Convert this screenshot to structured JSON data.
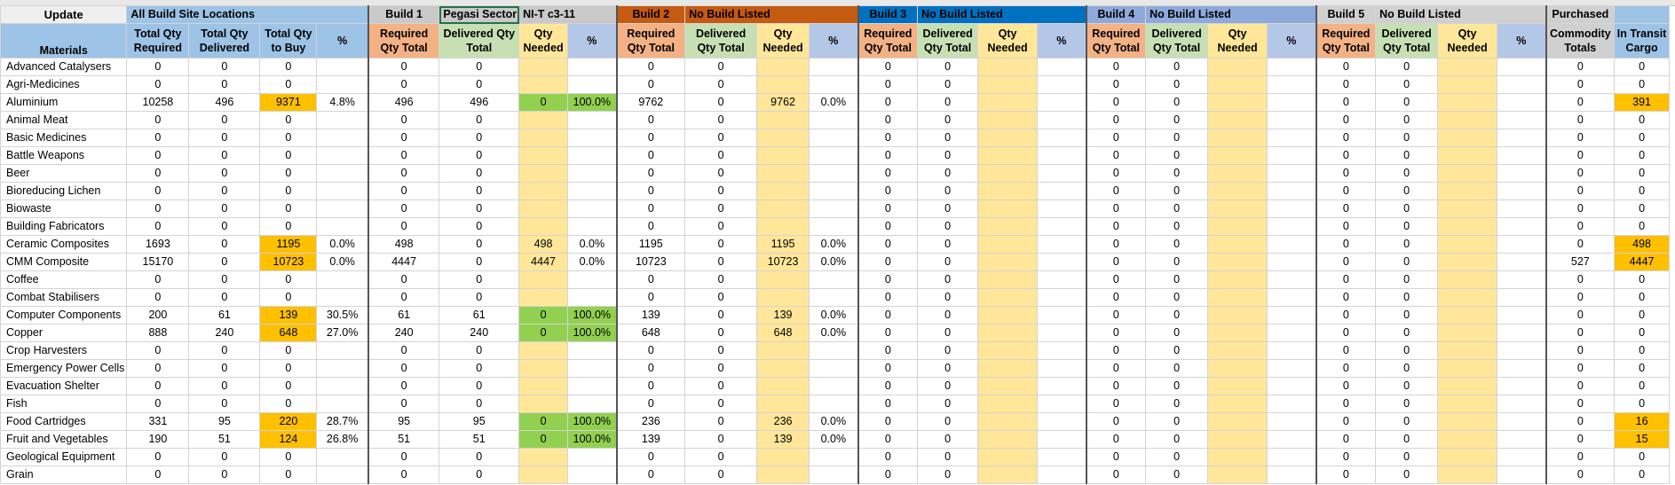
{
  "update_label": "Update",
  "header1": {
    "all_sites": "All Build Site Locations",
    "build1": "Build 1",
    "build1_site": "Pegasi Sector",
    "build1_site2": "NI-T c3-11",
    "build2": "Build 2",
    "build2_site": "No Build Listed",
    "build3": "Build 3",
    "build3_site": "No Build Listed",
    "build4": "Build 4",
    "build4_site": "No Build Listed",
    "build5": "Build 5",
    "build5_site": "No Build Listed",
    "purchased": "Purchased",
    "in_transit": ""
  },
  "header2": {
    "materials": "Materials",
    "total_req": "Total Qty Required",
    "total_del": "Total Qty Delivered",
    "total_buy": "Total Qty to Buy",
    "pct": "%",
    "req_total": "Required Qty Total",
    "del_total": "Delivered Qty Total",
    "qty_needed": "Qty Needed",
    "commodity": "Commodity Totals",
    "in_transit": "In Transit Cargo"
  },
  "rows": [
    {
      "name": "Advanced Catalysers",
      "tr": "0",
      "td": "0",
      "tb": "0",
      "p": "",
      "b1r": "0",
      "b1d": "0",
      "b1n": "",
      "b1p": "",
      "b2r": "0",
      "b2d": "0",
      "b2n": "",
      "b2p": "",
      "pur": "0",
      "tra": "0"
    },
    {
      "name": "Agri-Medicines",
      "tr": "0",
      "td": "0",
      "tb": "0",
      "p": "",
      "b1r": "0",
      "b1d": "0",
      "b1n": "",
      "b1p": "",
      "b2r": "0",
      "b2d": "0",
      "b2n": "",
      "b2p": "",
      "pur": "0",
      "tra": "0"
    },
    {
      "name": "Aluminium",
      "tr": "10258",
      "td": "496",
      "tb": "9371",
      "p": "4.8%",
      "b1r": "496",
      "b1d": "496",
      "b1n": "0",
      "b1p": "100.0%",
      "b2r": "9762",
      "b2d": "0",
      "b2n": "9762",
      "b2p": "0.0%",
      "pur": "0",
      "tra": "391"
    },
    {
      "name": "Animal Meat",
      "tr": "0",
      "td": "0",
      "tb": "0",
      "p": "",
      "b1r": "0",
      "b1d": "0",
      "b1n": "",
      "b1p": "",
      "b2r": "0",
      "b2d": "0",
      "b2n": "",
      "b2p": "",
      "pur": "0",
      "tra": "0"
    },
    {
      "name": "Basic Medicines",
      "tr": "0",
      "td": "0",
      "tb": "0",
      "p": "",
      "b1r": "0",
      "b1d": "0",
      "b1n": "",
      "b1p": "",
      "b2r": "0",
      "b2d": "0",
      "b2n": "",
      "b2p": "",
      "pur": "0",
      "tra": "0"
    },
    {
      "name": "Battle Weapons",
      "tr": "0",
      "td": "0",
      "tb": "0",
      "p": "",
      "b1r": "0",
      "b1d": "0",
      "b1n": "",
      "b1p": "",
      "b2r": "0",
      "b2d": "0",
      "b2n": "",
      "b2p": "",
      "pur": "0",
      "tra": "0"
    },
    {
      "name": "Beer",
      "tr": "0",
      "td": "0",
      "tb": "0",
      "p": "",
      "b1r": "0",
      "b1d": "0",
      "b1n": "",
      "b1p": "",
      "b2r": "0",
      "b2d": "0",
      "b2n": "",
      "b2p": "",
      "pur": "0",
      "tra": "0"
    },
    {
      "name": "Bioreducing Lichen",
      "tr": "0",
      "td": "0",
      "tb": "0",
      "p": "",
      "b1r": "0",
      "b1d": "0",
      "b1n": "",
      "b1p": "",
      "b2r": "0",
      "b2d": "0",
      "b2n": "",
      "b2p": "",
      "pur": "0",
      "tra": "0"
    },
    {
      "name": "Biowaste",
      "tr": "0",
      "td": "0",
      "tb": "0",
      "p": "",
      "b1r": "0",
      "b1d": "0",
      "b1n": "",
      "b1p": "",
      "b2r": "0",
      "b2d": "0",
      "b2n": "",
      "b2p": "",
      "pur": "0",
      "tra": "0"
    },
    {
      "name": "Building Fabricators",
      "tr": "0",
      "td": "0",
      "tb": "0",
      "p": "",
      "b1r": "0",
      "b1d": "0",
      "b1n": "",
      "b1p": "",
      "b2r": "0",
      "b2d": "0",
      "b2n": "",
      "b2p": "",
      "pur": "0",
      "tra": "0"
    },
    {
      "name": "Ceramic Composites",
      "tr": "1693",
      "td": "0",
      "tb": "1195",
      "p": "0.0%",
      "b1r": "498",
      "b1d": "0",
      "b1n": "498",
      "b1p": "0.0%",
      "b2r": "1195",
      "b2d": "0",
      "b2n": "1195",
      "b2p": "0.0%",
      "pur": "0",
      "tra": "498"
    },
    {
      "name": "CMM Composite",
      "tr": "15170",
      "td": "0",
      "tb": "10723",
      "p": "0.0%",
      "b1r": "4447",
      "b1d": "0",
      "b1n": "4447",
      "b1p": "0.0%",
      "b2r": "10723",
      "b2d": "0",
      "b2n": "10723",
      "b2p": "0.0%",
      "pur": "527",
      "tra": "4447"
    },
    {
      "name": "Coffee",
      "tr": "0",
      "td": "0",
      "tb": "0",
      "p": "",
      "b1r": "0",
      "b1d": "0",
      "b1n": "",
      "b1p": "",
      "b2r": "0",
      "b2d": "0",
      "b2n": "",
      "b2p": "",
      "pur": "0",
      "tra": "0"
    },
    {
      "name": "Combat Stabilisers",
      "tr": "0",
      "td": "0",
      "tb": "0",
      "p": "",
      "b1r": "0",
      "b1d": "0",
      "b1n": "",
      "b1p": "",
      "b2r": "0",
      "b2d": "0",
      "b2n": "",
      "b2p": "",
      "pur": "0",
      "tra": "0"
    },
    {
      "name": "Computer Components",
      "tr": "200",
      "td": "61",
      "tb": "139",
      "p": "30.5%",
      "b1r": "61",
      "b1d": "61",
      "b1n": "0",
      "b1p": "100.0%",
      "b2r": "139",
      "b2d": "0",
      "b2n": "139",
      "b2p": "0.0%",
      "pur": "0",
      "tra": "0"
    },
    {
      "name": "Copper",
      "tr": "888",
      "td": "240",
      "tb": "648",
      "p": "27.0%",
      "b1r": "240",
      "b1d": "240",
      "b1n": "0",
      "b1p": "100.0%",
      "b2r": "648",
      "b2d": "0",
      "b2n": "648",
      "b2p": "0.0%",
      "pur": "0",
      "tra": "0"
    },
    {
      "name": "Crop Harvesters",
      "tr": "0",
      "td": "0",
      "tb": "0",
      "p": "",
      "b1r": "0",
      "b1d": "0",
      "b1n": "",
      "b1p": "",
      "b2r": "0",
      "b2d": "0",
      "b2n": "",
      "b2p": "",
      "pur": "0",
      "tra": "0"
    },
    {
      "name": "Emergency Power Cells",
      "tr": "0",
      "td": "0",
      "tb": "0",
      "p": "",
      "b1r": "0",
      "b1d": "0",
      "b1n": "",
      "b1p": "",
      "b2r": "0",
      "b2d": "0",
      "b2n": "",
      "b2p": "",
      "pur": "0",
      "tra": "0"
    },
    {
      "name": "Evacuation Shelter",
      "tr": "0",
      "td": "0",
      "tb": "0",
      "p": "",
      "b1r": "0",
      "b1d": "0",
      "b1n": "",
      "b1p": "",
      "b2r": "0",
      "b2d": "0",
      "b2n": "",
      "b2p": "",
      "pur": "0",
      "tra": "0"
    },
    {
      "name": "Fish",
      "tr": "0",
      "td": "0",
      "tb": "0",
      "p": "",
      "b1r": "0",
      "b1d": "0",
      "b1n": "",
      "b1p": "",
      "b2r": "0",
      "b2d": "0",
      "b2n": "",
      "b2p": "",
      "pur": "0",
      "tra": "0"
    },
    {
      "name": "Food Cartridges",
      "tr": "331",
      "td": "95",
      "tb": "220",
      "p": "28.7%",
      "b1r": "95",
      "b1d": "95",
      "b1n": "0",
      "b1p": "100.0%",
      "b2r": "236",
      "b2d": "0",
      "b2n": "236",
      "b2p": "0.0%",
      "pur": "0",
      "tra": "16"
    },
    {
      "name": "Fruit and Vegetables",
      "tr": "190",
      "td": "51",
      "tb": "124",
      "p": "26.8%",
      "b1r": "51",
      "b1d": "51",
      "b1n": "0",
      "b1p": "100.0%",
      "b2r": "139",
      "b2d": "0",
      "b2n": "139",
      "b2p": "0.0%",
      "pur": "0",
      "tra": "15"
    },
    {
      "name": "Geological Equipment",
      "tr": "0",
      "td": "0",
      "tb": "0",
      "p": "",
      "b1r": "0",
      "b1d": "0",
      "b1n": "",
      "b1p": "",
      "b2r": "0",
      "b2d": "0",
      "b2n": "",
      "b2p": "",
      "pur": "0",
      "tra": "0"
    },
    {
      "name": "Grain",
      "tr": "0",
      "td": "0",
      "tb": "0",
      "p": "",
      "b1r": "0",
      "b1d": "0",
      "b1n": "",
      "b1p": "",
      "b2r": "0",
      "b2d": "0",
      "b2n": "",
      "b2p": "",
      "pur": "0",
      "tra": "0"
    }
  ],
  "zero": "0"
}
